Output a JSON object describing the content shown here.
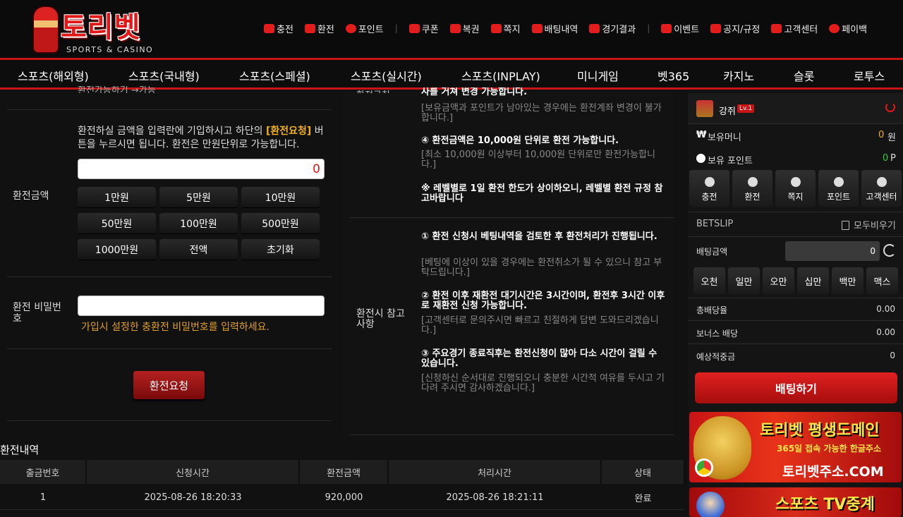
{
  "logo": {
    "brand": "토리벳",
    "sub": "SPORTS & CASINO"
  },
  "topnav": [
    "충전",
    "환전",
    "포인트",
    "|",
    "쿠폰",
    "복권",
    "쪽지",
    "배팅내역",
    "경기결과",
    "|",
    "이벤트",
    "공지/규정",
    "고객센터",
    "페이백"
  ],
  "mainnav": [
    "스포츠(해외형)",
    "스포츠(국내형)",
    "스포츠(스페셜)",
    "스포츠(실시간)",
    "스포츠(INPLAY)",
    "미니게임",
    "벳365",
    "카지노",
    "슬롯",
    "로투스"
  ],
  "form": {
    "top_cut_text": "환전가능하기 →가능",
    "amount_label": "환전금액",
    "instruction_pre": "환전하실 금액을 입력란에 기입하시고 하단의 ",
    "instruction_hl": "[환전요청]",
    "instruction_post1": " 버",
    "instruction_line2": "튼을 누르시면 됩니다. 환전은 만원단위로 가능합니다.",
    "amount_value": "0",
    "amount_buttons": [
      "1만원",
      "5만원",
      "10만원",
      "50만원",
      "100만원",
      "500만원",
      "1000만원",
      "전액",
      "초기화"
    ],
    "password_label": "환전 비밀번호",
    "password_hint": "가입시 설정한 충환전 비밀번호를 입력하세요.",
    "request_button": "환전요청"
  },
  "notes": {
    "cut_label": "환전규칙",
    "cut_line": "사를 거쳐 변경 가능합니다.",
    "cut_sub": "[보유금액과 포인트가 남아있는 경우에는 환전계좌 변경이 불가합니다.]",
    "n4": "④ 환전금액은 10,000원 단위로 환전 가능합니다.",
    "n4_sub": "[최소 10,000원 이상부터 10,000원 단위로만 환전가능합니다.]",
    "level": "※ 레벨별로 1일 환전 한도가 상이하오니, 레벨별 환전 규정 참고바랍니다",
    "ref_label": "환전시 참고사항",
    "r1": "① 환전 신청시 베팅내역을 검토한 후 환전처리가 진행됩니다.",
    "r1_sub": "[베팅에 이상이 있을 경우에는 환전취소가 될 수 있으니 참고 부탁드립니다.]",
    "r2": "② 환전 이후 재환전 대기시간은 3시간이며, 환전후 3시간 이후로 재환전 신청 가능합니다.",
    "r2_sub": "[고객센터로 문의주시면 빠르고 친절하게 답변 도와드리겠습니다.]",
    "r3": "③ 주요경기 종료직후는 환전신청이 많아 다소 시간이 걸릴 수 있습니다.",
    "r3_sub": "[신청하신 순서대로 진행되오니 충분한 시간적 여유를 두시고 기다려 주시면 감사하겠습니다.]"
  },
  "history": {
    "title": "환전내역",
    "columns": [
      "출금번호",
      "신청시간",
      "환전금액",
      "처리시간",
      "상태"
    ],
    "rows": [
      [
        "1",
        "2025-08-26 18:20:33",
        "920,000",
        "2025-08-26 18:21:11",
        "완료"
      ]
    ]
  },
  "right": {
    "username": "강쥐",
    "level": "Lv.1",
    "money_label": "보유머니",
    "money_value": "0",
    "money_unit": "원",
    "point_label": "보유 포인트",
    "point_value": "0",
    "point_unit": "P",
    "quick": [
      "충전",
      "환전",
      "쪽지",
      "포인트",
      "고객센터"
    ],
    "betslip": "BETSLIP",
    "clear_all": "모두비우기",
    "bet_amount_label": "배팅금액",
    "bet_amount_value": "0",
    "chips": [
      "오천",
      "일만",
      "오만",
      "십만",
      "백만",
      "맥스"
    ],
    "total_odds_label": "총배당율",
    "total_odds": "0.00",
    "bonus_label": "보너스 배당",
    "bonus": "0.00",
    "expected_label": "예상적중금",
    "expected": "0",
    "bet_button": "배팅하기",
    "banner1_title": "토리벳 평생도메인",
    "banner1_sub": "365일 접속 가능한 한글주소",
    "banner1_url": "토리벳주소.COM",
    "banner2_title": "스포츠 TV중계"
  },
  "colors": {
    "accent": "#c81414",
    "highlight": "#f0b020",
    "hint": "#e0a030"
  }
}
